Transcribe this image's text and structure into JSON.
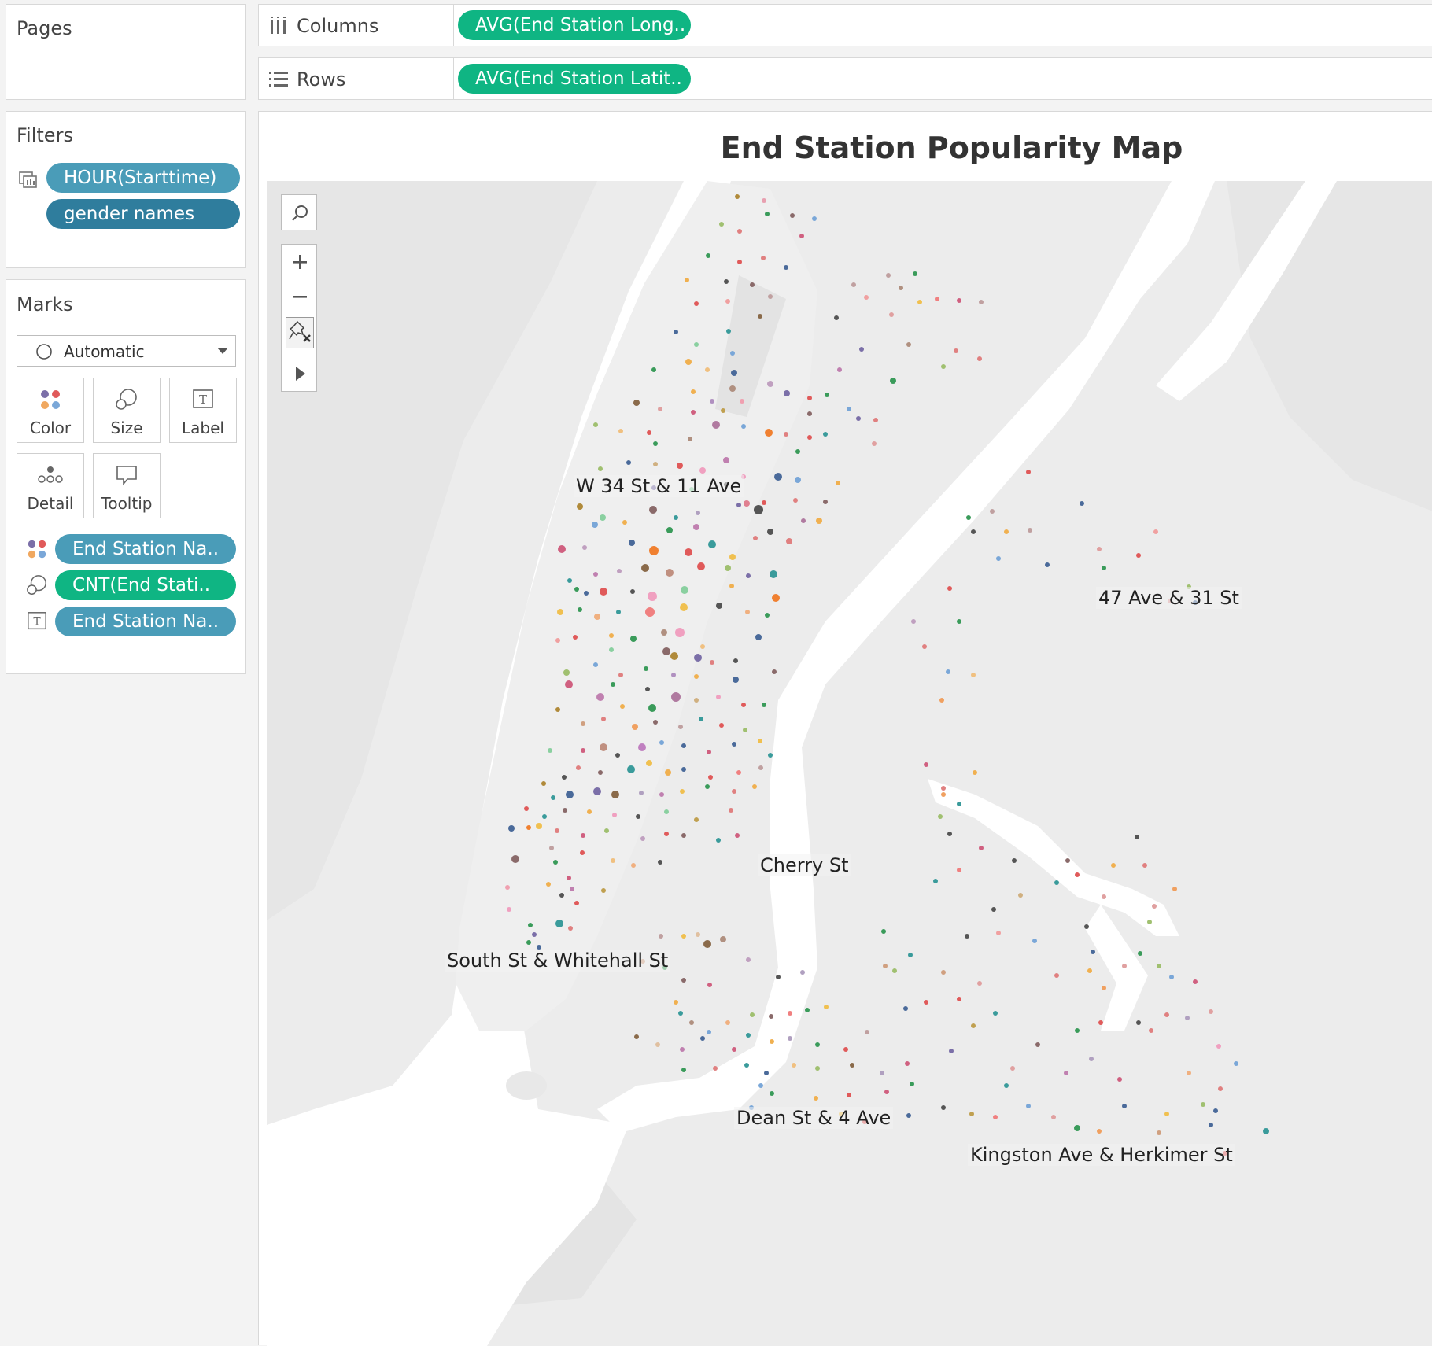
{
  "pages": {
    "title": "Pages"
  },
  "shelves": {
    "columns": {
      "label": "Columns",
      "pill": "AVG(End Station Long.."
    },
    "rows": {
      "label": "Rows",
      "pill": "AVG(End Station Latit.."
    }
  },
  "filters": {
    "title": "Filters",
    "items": [
      "HOUR(Starttime)",
      "gender names"
    ]
  },
  "marks": {
    "title": "Marks",
    "mark_type": "Automatic",
    "buttons": [
      "Color",
      "Size",
      "Label",
      "Detail",
      "Tooltip"
    ],
    "fields": [
      "End Station Na..",
      "CNT(End Stati..",
      "End Station Na.."
    ]
  },
  "view": {
    "title": "End Station Popularity Map",
    "labels": [
      "W 34 St & 11 Ave",
      "47 Ave & 31 St",
      "Cherry St",
      "South St & Whitehall St",
      "Dean St & 4 Ave",
      "Kingston Ave & Herkimer St"
    ]
  },
  "colors": {
    "accent_green": "#0fb583",
    "pill_blue": "#4a9cb8",
    "pill_darkblue": "#2f7d9d",
    "water": "#ffffff",
    "land": "#ececec"
  }
}
